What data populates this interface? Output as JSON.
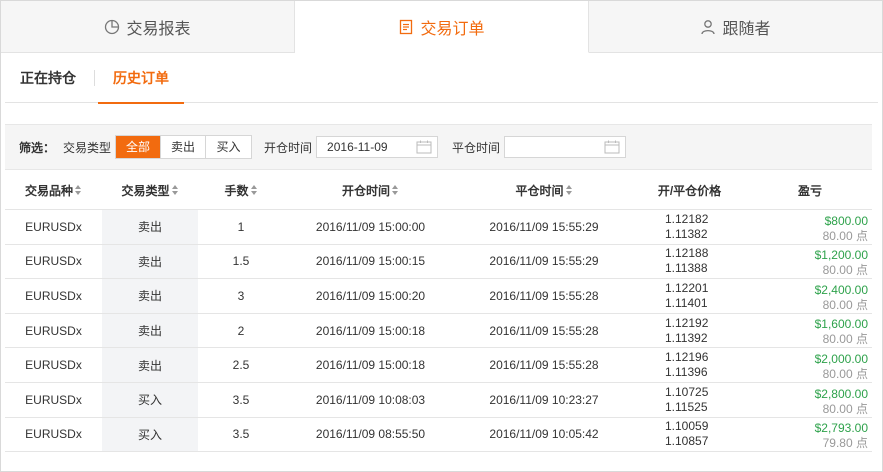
{
  "top_tabs": [
    {
      "label": "交易报表",
      "active": false
    },
    {
      "label": "交易订单",
      "active": true
    },
    {
      "label": "跟随者",
      "active": false
    }
  ],
  "sub_tabs": [
    {
      "label": "正在持仓",
      "active": false
    },
    {
      "label": "历史订单",
      "active": true
    }
  ],
  "filter": {
    "label": "筛选：",
    "type_label": "交易类型",
    "type_options": [
      "全部",
      "卖出",
      "买入"
    ],
    "type_selected": "全部",
    "open_time_label": "开仓时间",
    "open_time_value": "2016-11-09",
    "close_time_label": "平仓时间",
    "close_time_value": ""
  },
  "table": {
    "headers": [
      "交易品种",
      "交易类型",
      "手数",
      "开仓时间",
      "平仓时间",
      "开/平仓价格",
      "盈亏"
    ],
    "rows": [
      {
        "symbol": "EURUSDx",
        "type": "卖出",
        "lots": "1",
        "open_time": "2016/11/09 15:00:00",
        "close_time": "2016/11/09 15:55:29",
        "open_price": "1.12182",
        "close_price": "1.11382",
        "profit": "$800.00",
        "points": "80.00 点"
      },
      {
        "symbol": "EURUSDx",
        "type": "卖出",
        "lots": "1.5",
        "open_time": "2016/11/09 15:00:15",
        "close_time": "2016/11/09 15:55:29",
        "open_price": "1.12188",
        "close_price": "1.11388",
        "profit": "$1,200.00",
        "points": "80.00 点"
      },
      {
        "symbol": "EURUSDx",
        "type": "卖出",
        "lots": "3",
        "open_time": "2016/11/09 15:00:20",
        "close_time": "2016/11/09 15:55:28",
        "open_price": "1.12201",
        "close_price": "1.11401",
        "profit": "$2,400.00",
        "points": "80.00 点"
      },
      {
        "symbol": "EURUSDx",
        "type": "卖出",
        "lots": "2",
        "open_time": "2016/11/09 15:00:18",
        "close_time": "2016/11/09 15:55:28",
        "open_price": "1.12192",
        "close_price": "1.11392",
        "profit": "$1,600.00",
        "points": "80.00 点"
      },
      {
        "symbol": "EURUSDx",
        "type": "卖出",
        "lots": "2.5",
        "open_time": "2016/11/09 15:00:18",
        "close_time": "2016/11/09 15:55:28",
        "open_price": "1.12196",
        "close_price": "1.11396",
        "profit": "$2,000.00",
        "points": "80.00 点"
      },
      {
        "symbol": "EURUSDx",
        "type": "买入",
        "lots": "3.5",
        "open_time": "2016/11/09 10:08:03",
        "close_time": "2016/11/09 10:23:27",
        "open_price": "1.10725",
        "close_price": "1.11525",
        "profit": "$2,800.00",
        "points": "80.00 点"
      },
      {
        "symbol": "EURUSDx",
        "type": "买入",
        "lots": "3.5",
        "open_time": "2016/11/09 08:55:50",
        "close_time": "2016/11/09 10:05:42",
        "open_price": "1.10059",
        "close_price": "1.10857",
        "profit": "$2,793.00",
        "points": "79.80 点"
      }
    ]
  },
  "colors": {
    "accent": "#f26b0f",
    "profit": "#2ea24b"
  },
  "icons": {
    "tab0": "pie-chart-icon",
    "tab1": "document-list-icon",
    "tab2": "user-icon",
    "date": "calendar-icon"
  }
}
